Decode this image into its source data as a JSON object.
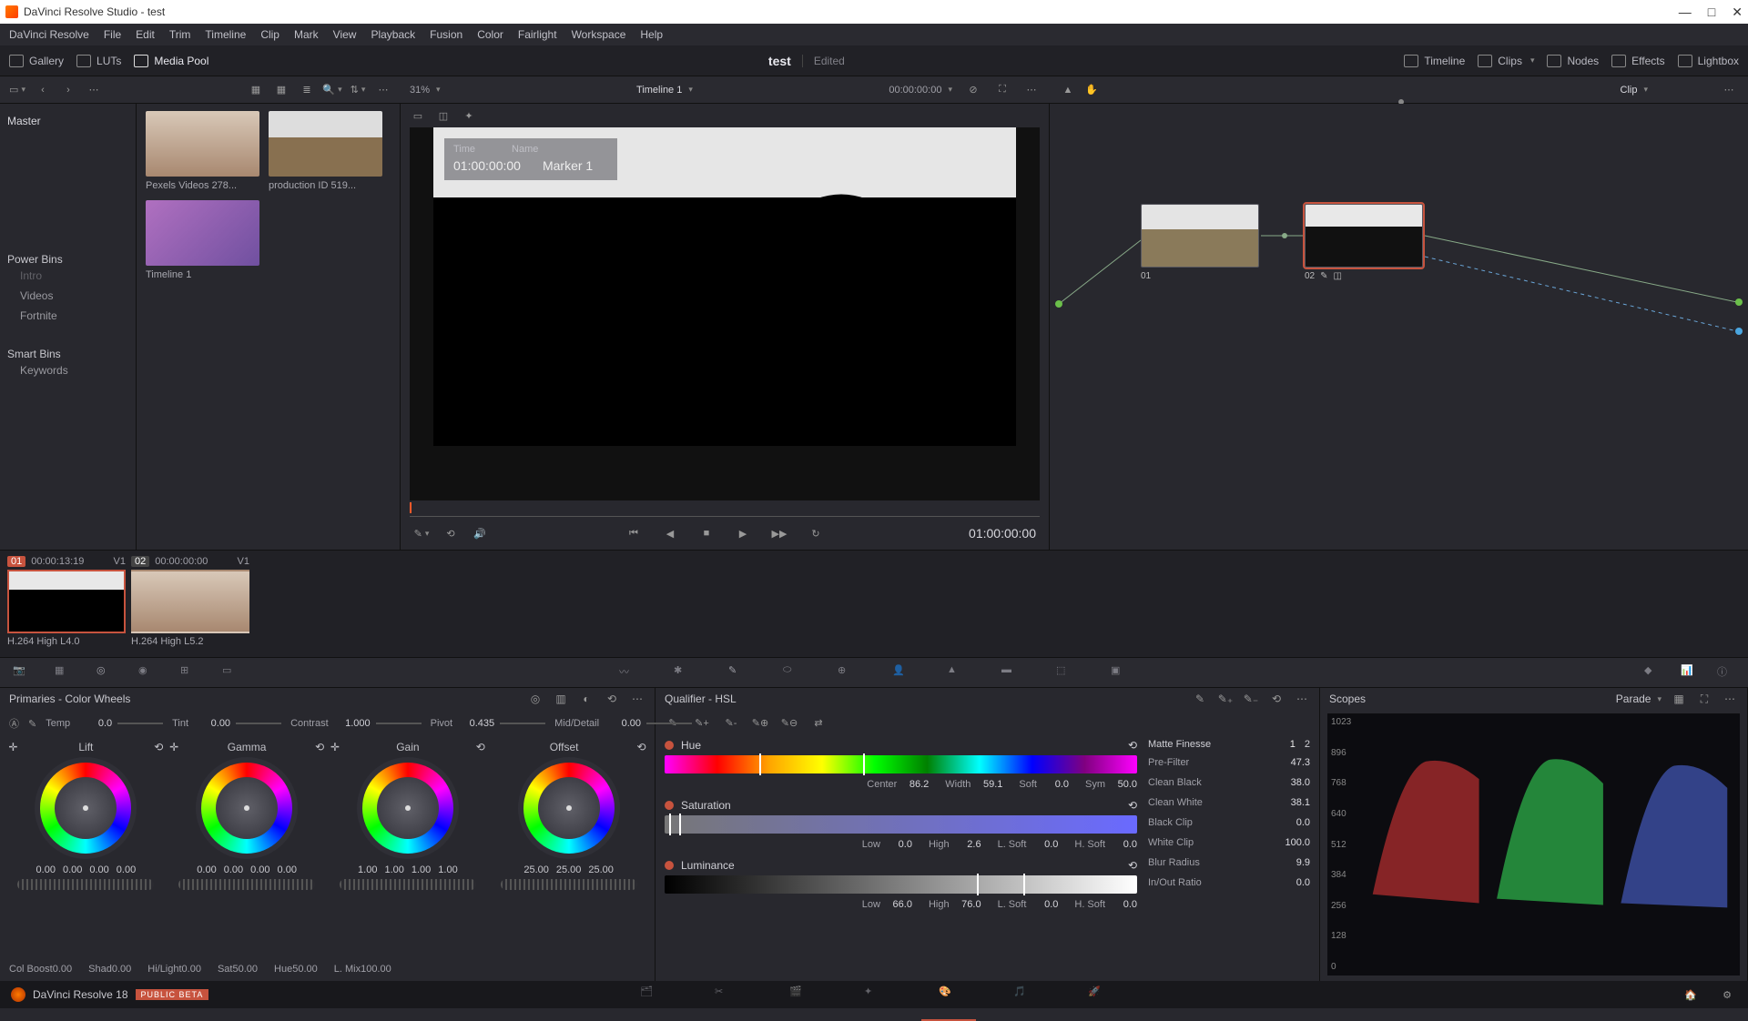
{
  "window": {
    "title": "DaVinci Resolve Studio - test"
  },
  "menubar": [
    "DaVinci Resolve",
    "File",
    "Edit",
    "Trim",
    "Timeline",
    "Clip",
    "Mark",
    "View",
    "Playback",
    "Fusion",
    "Color",
    "Fairlight",
    "Workspace",
    "Help"
  ],
  "top_tabs": {
    "gallery": "Gallery",
    "luts": "LUTs",
    "media_pool": "Media Pool",
    "project": "test",
    "edited": "Edited",
    "timeline": "Timeline",
    "clips": "Clips",
    "nodes": "Nodes",
    "effects": "Effects",
    "lightbox": "Lightbox"
  },
  "sub": {
    "zoom": "31%",
    "timeline_name": "Timeline 1",
    "timecode": "00:00:00:00",
    "clip_label": "Clip"
  },
  "bins": {
    "master": "Master",
    "power_bins_label": "Power Bins",
    "power_bins": [
      "Intro",
      "Videos",
      "Fortnite"
    ],
    "smart_bins_label": "Smart Bins",
    "smart_bins": [
      "Keywords"
    ]
  },
  "pool_clips": [
    {
      "label": "Pexels Videos 278..."
    },
    {
      "label": "production ID 519..."
    },
    {
      "label": "Timeline 1"
    }
  ],
  "viewer": {
    "overlay_hdr_time": "Time",
    "overlay_hdr_name": "Name",
    "overlay_time": "01:00:00:00",
    "overlay_name": "Marker 1",
    "tc": "01:00:00:00"
  },
  "nodes": {
    "n1": "01",
    "n2": "02"
  },
  "strip": [
    {
      "idx": "01",
      "tc": "00:00:13:19",
      "track": "V1",
      "caption": "H.264 High L4.0",
      "active": true
    },
    {
      "idx": "02",
      "tc": "00:00:00:00",
      "track": "V1",
      "caption": "H.264 High L5.2",
      "active": false
    }
  ],
  "primaries": {
    "title": "Primaries - Color Wheels",
    "adj": {
      "temp_l": "Temp",
      "temp": "0.0",
      "tint_l": "Tint",
      "tint": "0.00",
      "contrast_l": "Contrast",
      "contrast": "1.000",
      "pivot_l": "Pivot",
      "pivot": "0.435",
      "mid_l": "Mid/Detail",
      "mid": "0.00"
    },
    "wheels": {
      "lift": {
        "title": "Lift",
        "vals": [
          "0.00",
          "0.00",
          "0.00",
          "0.00"
        ]
      },
      "gamma": {
        "title": "Gamma",
        "vals": [
          "0.00",
          "0.00",
          "0.00",
          "0.00"
        ]
      },
      "gain": {
        "title": "Gain",
        "vals": [
          "1.00",
          "1.00",
          "1.00",
          "1.00"
        ]
      },
      "offset": {
        "title": "Offset",
        "vals": [
          "25.00",
          "25.00",
          "25.00"
        ]
      }
    },
    "bottom": {
      "colboost_l": "Col Boost",
      "colboost": "0.00",
      "shad_l": "Shad",
      "shad": "0.00",
      "hilight_l": "Hi/Light",
      "hilight": "0.00",
      "sat_l": "Sat",
      "sat": "50.00",
      "hue_l": "Hue",
      "hue": "50.00",
      "lmix_l": "L. Mix",
      "lmix": "100.00"
    }
  },
  "qualifier": {
    "title": "Qualifier - HSL",
    "hue": {
      "label": "Hue",
      "center_l": "Center",
      "center": "86.2",
      "width_l": "Width",
      "width": "59.1",
      "soft_l": "Soft",
      "soft": "0.0",
      "sym_l": "Sym",
      "sym": "50.0"
    },
    "sat": {
      "label": "Saturation",
      "low_l": "Low",
      "low": "0.0",
      "high_l": "High",
      "high": "2.6",
      "lsoft_l": "L. Soft",
      "lsoft": "0.0",
      "hsoft_l": "H. Soft",
      "hsoft": "0.0"
    },
    "lum": {
      "label": "Luminance",
      "low_l": "Low",
      "low": "66.0",
      "high_l": "High",
      "high": "76.0",
      "lsoft_l": "L. Soft",
      "lsoft": "0.0",
      "hsoft_l": "H. Soft",
      "hsoft": "0.0"
    },
    "matte": {
      "title": "Matte Finesse",
      "tab1": "1",
      "tab2": "2",
      "prefilter_l": "Pre-Filter",
      "prefilter": "47.3",
      "cleanblack_l": "Clean Black",
      "cleanblack": "38.0",
      "cleanwhite_l": "Clean White",
      "cleanwhite": "38.1",
      "blackclip_l": "Black Clip",
      "blackclip": "0.0",
      "whiteclip_l": "White Clip",
      "whiteclip": "100.0",
      "blur_l": "Blur Radius",
      "blur": "9.9",
      "inout_l": "In/Out Ratio",
      "inout": "0.0"
    }
  },
  "scopes": {
    "title": "Scopes",
    "mode": "Parade",
    "ticks": [
      "1023",
      "896",
      "768",
      "640",
      "512",
      "384",
      "256",
      "128",
      "0"
    ]
  },
  "footer": {
    "brand": "DaVinci Resolve 18",
    "beta": "PUBLIC BETA"
  }
}
